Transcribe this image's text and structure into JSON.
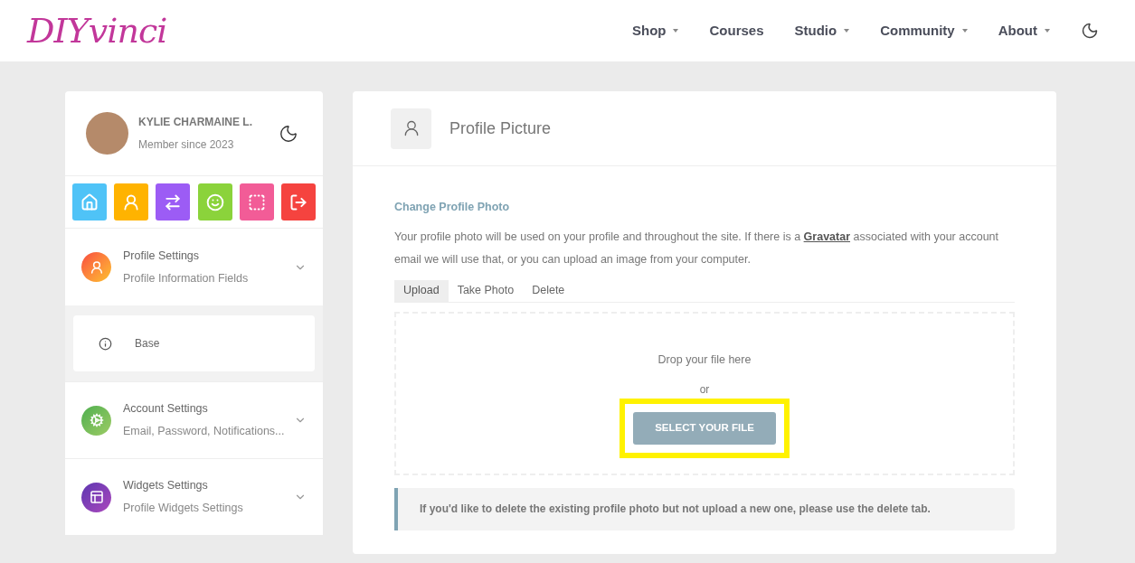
{
  "header": {
    "logo": "DIYvinci",
    "nav": [
      {
        "label": "Shop",
        "dropdown": true
      },
      {
        "label": "Courses",
        "dropdown": false
      },
      {
        "label": "Studio",
        "dropdown": true
      },
      {
        "label": "Community",
        "dropdown": true
      },
      {
        "label": "About",
        "dropdown": true
      }
    ]
  },
  "sidebar": {
    "user": {
      "name": "KYLIE CHARMAINE L.",
      "since": "Member since 2023"
    },
    "shortcuts": [
      {
        "kind": "home",
        "color": "#4fc3f7"
      },
      {
        "kind": "profile",
        "color": "#ffb300"
      },
      {
        "kind": "swap",
        "color": "#9c5cf5"
      },
      {
        "kind": "smile",
        "color": "#8bd33b"
      },
      {
        "kind": "frame",
        "color": "#f25c97"
      },
      {
        "kind": "logout",
        "color": "#f5433f"
      }
    ],
    "sections": [
      {
        "kind": "profile",
        "title": "Profile Settings",
        "subtitle": "Profile Information Fields",
        "children": [
          {
            "label": "Base"
          }
        ]
      },
      {
        "kind": "account",
        "title": "Account Settings",
        "subtitle": "Email, Password, Notifications..."
      },
      {
        "kind": "widgets",
        "title": "Widgets Settings",
        "subtitle": "Profile Widgets Settings"
      }
    ]
  },
  "main": {
    "title": "Profile Picture",
    "heading": "Change Profile Photo",
    "description": {
      "before": "Your profile photo will be used on your profile and throughout the site. If there is a ",
      "link": "Gravatar",
      "after": " associated with your account email we will use that, or you can upload an image from your computer."
    },
    "tabs": [
      {
        "label": "Upload",
        "selected": true
      },
      {
        "label": "Take Photo",
        "selected": false
      },
      {
        "label": "Delete",
        "selected": false
      }
    ],
    "dropzone": {
      "text": "Drop your file here",
      "or": "or",
      "button": "SELECT YOUR FILE",
      "highlighted": true
    },
    "notice": "If you'd like to delete the existing profile photo but not upload a new one, please use the delete tab."
  }
}
